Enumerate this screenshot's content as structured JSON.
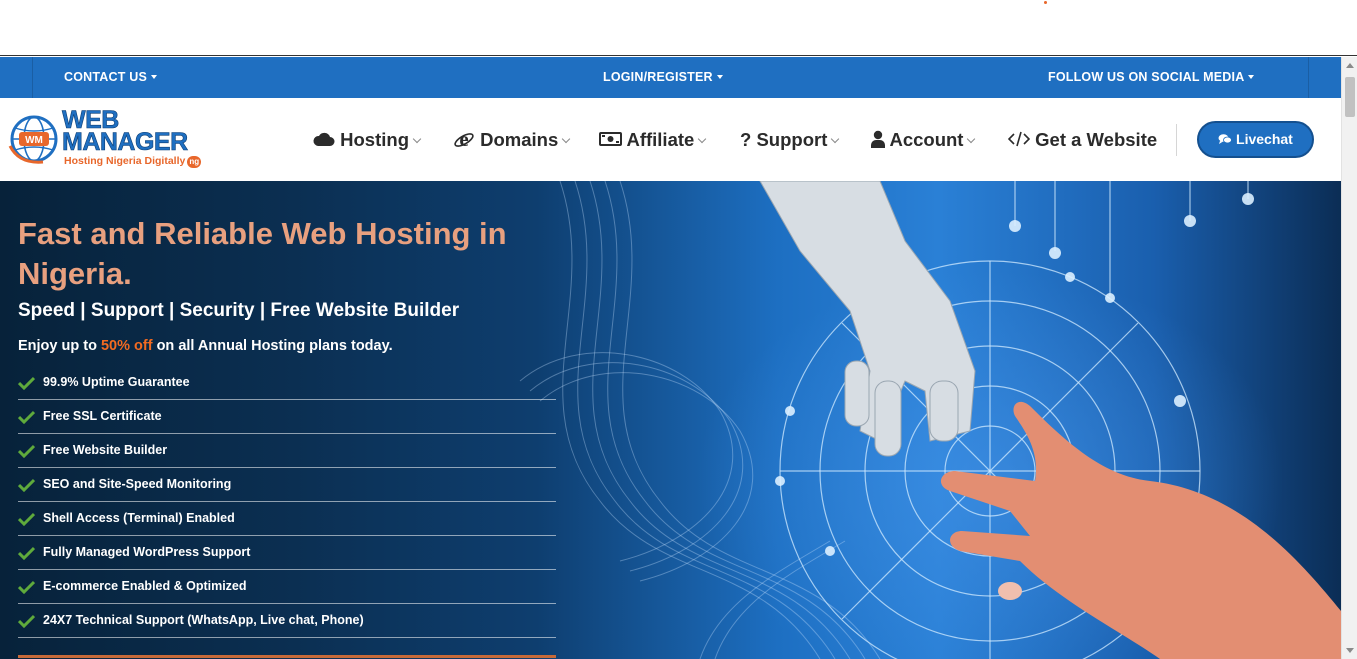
{
  "topbar": {
    "contact": "CONTACT US",
    "login": "LOGIN/REGISTER",
    "social": "FOLLOW US ON SOCIAL MEDIA"
  },
  "logo": {
    "line1": "WEB",
    "line2": "MANAGER",
    "monogram": "WM",
    "tagline": "Hosting Nigeria Digitally",
    "badge": "ng"
  },
  "nav": {
    "items": [
      {
        "label": "Hosting",
        "icon": "cloud-icon"
      },
      {
        "label": "Domains",
        "icon": "internet-explorer-icon"
      },
      {
        "label": "Affiliate",
        "icon": "money-icon"
      },
      {
        "label": "Support",
        "icon": "question-icon"
      },
      {
        "label": "Account",
        "icon": "user-icon"
      },
      {
        "label": "Get a Website",
        "icon": "code-icon"
      }
    ],
    "livechat": "Livechat"
  },
  "hero": {
    "title": "Fast and Reliable Web Hosting in Nigeria.",
    "subtitle": "Speed | Support | Security | Free Website Builder",
    "offer_pre": "Enjoy up to ",
    "offer_highlight": "50% off",
    "offer_post": " on all Annual Hosting plans today.",
    "features": [
      "99.9% Uptime Guarantee",
      "Free SSL Certificate",
      "Free Website Builder",
      "SEO and Site-Speed Monitoring",
      "Shell Access (Terminal) Enabled",
      "Fully Managed WordPress Support",
      "E-commerce Enabled & Optimized",
      "24X7 Technical Support (WhatsApp, Live chat, Phone)"
    ]
  },
  "colors": {
    "brand_blue": "#1f6fc1",
    "accent_orange": "#f36b21",
    "title_peach": "#e8a07f",
    "check_green": "#5faa3c"
  }
}
